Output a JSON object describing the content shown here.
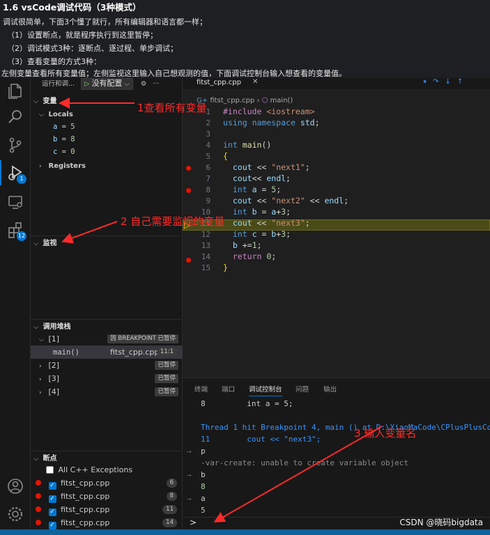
{
  "article": {
    "title": "1.6 vsCode调试代码（3种模式）",
    "lines": [
      "调试很简单，下面3个懂了就行，所有编辑器和语言都一样；",
      "（1）设置断点，就是程序执行到这里暂停；",
      "（2）调试模式3种：逐断点、逐过程、单步调试；",
      "（3）查看变量的方式3种：",
      "左侧变量查看所有变量值；左侧监视这里输入自己想观测的值，下面调试控制台输入想查看的变量值。"
    ]
  },
  "activity": {
    "debug_badge": "1",
    "extensions_badge": "12"
  },
  "debug_toolbar": {
    "label": "运行和调...",
    "config": "没有配置"
  },
  "sidebar": {
    "variables_title": "变量",
    "locals_label": "Locals",
    "locals": [
      {
        "name": "a",
        "value": "5"
      },
      {
        "name": "b",
        "value": "8"
      },
      {
        "name": "c",
        "value": "0"
      }
    ],
    "registers_label": "Registers",
    "watch_title": "监视",
    "callstack_title": "调用堆栈",
    "threads": [
      {
        "id": "[1]",
        "status": "因 BREAKPOINT 已暂停",
        "expanded": true
      },
      {
        "id": "[2]",
        "status": "已暂停"
      },
      {
        "id": "[3]",
        "status": "已暂停"
      },
      {
        "id": "[4]",
        "status": "已暂停"
      }
    ],
    "frame": {
      "fn": "main()",
      "file": "fitst_cpp.cpp",
      "pos": "11:1"
    },
    "breakpoints_title": "断点",
    "bp_exceptions": "All C++ Exceptions",
    "breakpoints": [
      {
        "file": "fitst_cpp.cpp",
        "line": "6"
      },
      {
        "file": "fitst_cpp.cpp",
        "line": "8"
      },
      {
        "file": "fitst_cpp.cpp",
        "line": "11"
      },
      {
        "file": "fitst_cpp.cpp",
        "line": "14"
      }
    ]
  },
  "editor": {
    "tab": "fitst_cpp.cpp",
    "breadcrumb_file": "fitst_cpp.cpp",
    "breadcrumb_fn": "main()",
    "line_numbers": [
      "1",
      "2",
      "3",
      "4",
      "5",
      "6",
      "7",
      "8",
      "9",
      "10",
      "11",
      "12",
      "13",
      "14",
      "15"
    ]
  },
  "panel": {
    "tabs": [
      "终端",
      "端口",
      "调试控制台",
      "问题",
      "输出"
    ],
    "active_tab": "调试控制台",
    "console": [
      "8         int a = 5;",
      "",
      "Thread 1 hit Breakpoint 4, main () at D:\\XiaoMaCode\\CPlusPlusCode",
      "11        cout << \"next3\";",
      "p",
      "-var-create: unable to create variable object",
      "b",
      "8",
      "a",
      "5"
    ],
    "prompt": ">"
  },
  "annotations": {
    "a1": "1查看所有变量",
    "a2": "2 自己需要监视的变量",
    "a3": "3 输入变量名"
  },
  "watermark": "CSDN @晓码bigdata",
  "colors": {
    "accent": "#0078d4",
    "breakpoint": "#e51400",
    "annotation": "#ff2a2a",
    "current_line": "#4b4b18"
  }
}
